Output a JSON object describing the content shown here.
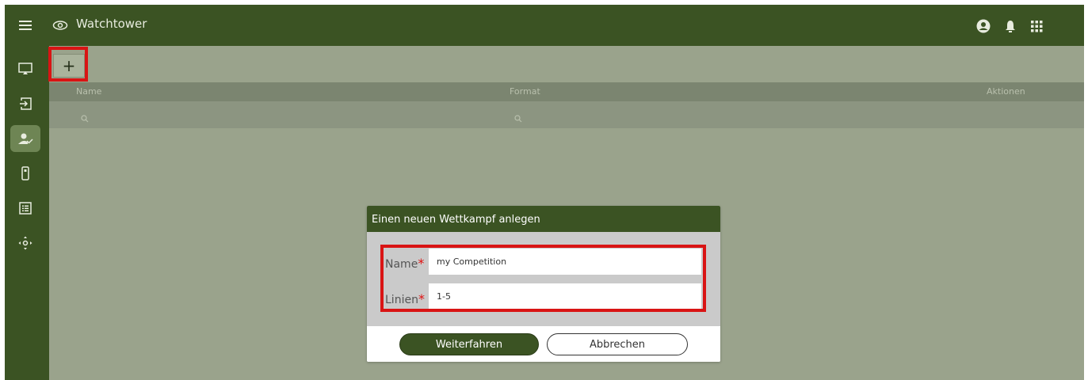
{
  "app": {
    "title": "Watchtower",
    "icons": {
      "menu": "hamburger-menu-icon",
      "brand": "eye-icon",
      "account": "account-circle-icon",
      "notifications": "bell-icon",
      "apps": "apps-grid-icon"
    }
  },
  "sidebar": {
    "items": [
      {
        "icon": "cast-icon",
        "active": false
      },
      {
        "icon": "login-icon",
        "active": false
      },
      {
        "icon": "person-check-icon",
        "active": true
      },
      {
        "icon": "remote-icon",
        "active": false
      },
      {
        "icon": "list-icon",
        "active": false
      },
      {
        "icon": "move-icon",
        "active": false
      }
    ]
  },
  "toolbar": {
    "add_label": "+"
  },
  "table": {
    "columns": [
      "Name",
      "Format",
      "Aktionen"
    ]
  },
  "dialog": {
    "title": "Einen neuen Wettkampf anlegen",
    "fields": [
      {
        "label": "Name",
        "required_mark": "*",
        "value": "my Competition"
      },
      {
        "label": "Linien",
        "required_mark": "*",
        "value": "1-5"
      }
    ],
    "confirm_label": "Weiterfahren",
    "cancel_label": "Abbrechen"
  },
  "colors": {
    "primary": "#3b5323",
    "background": "#9aa38c",
    "highlight": "#d91414",
    "required": "#e01010"
  }
}
